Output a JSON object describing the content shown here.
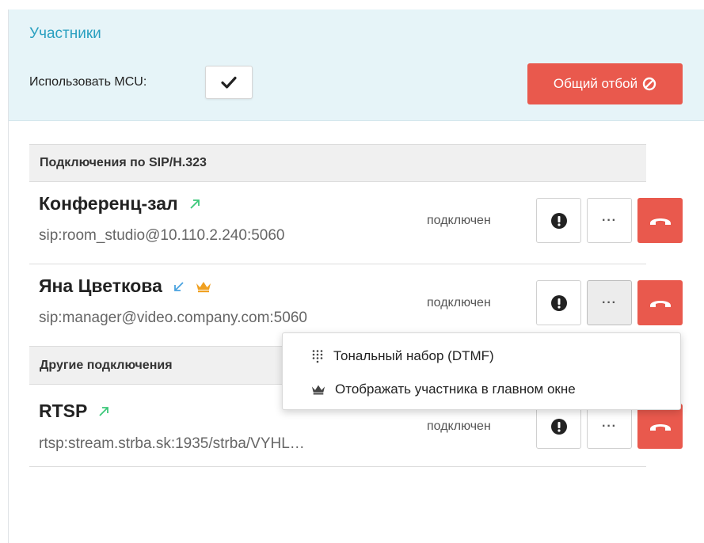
{
  "panel": {
    "title": "Участники",
    "mcu_label": "Использовать MCU:",
    "mcu_checked": true,
    "hangup_all_label": "Общий отбой"
  },
  "sections": {
    "sip": {
      "title": "Подключения по SIP/H.323"
    },
    "other": {
      "title": "Другие подключения"
    }
  },
  "participants": [
    {
      "name": "Конференц-зал",
      "address": "sip:room_studio@10.110.2.240:5060",
      "status": "подключен",
      "direction": "outgoing",
      "main_window": false
    },
    {
      "name": "Яна Цветкова",
      "address": "sip:manager@video.company.com:5060",
      "status": "подключен",
      "direction": "incoming",
      "main_window": true
    },
    {
      "name": "RTSP",
      "address": "rtsp:stream.strba.sk:1935/strba/VYHL…",
      "status": "подключен",
      "direction": "outgoing",
      "main_window": false
    }
  ],
  "more_label": "···",
  "dropdown": {
    "items": [
      {
        "label": "Тональный набор (DTMF)",
        "icon": "dialpad-icon"
      },
      {
        "label": "Отображать участника в главном окне",
        "icon": "crown-icon"
      }
    ]
  },
  "colors": {
    "header_bg": "#e6f4f8",
    "accent": "#2aa0c0",
    "danger": "#e9594d",
    "outgoing": "#3cc87a",
    "incoming": "#4aa3e0",
    "crown": "#f0a020"
  }
}
